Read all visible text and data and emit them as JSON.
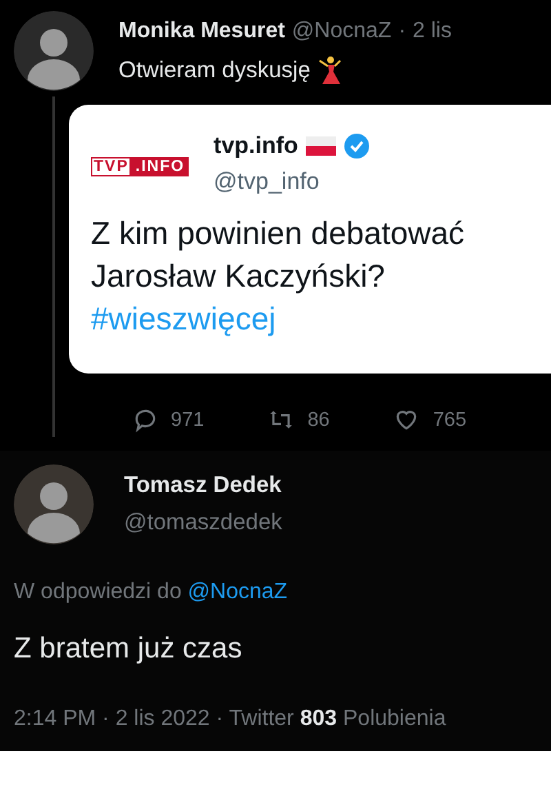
{
  "tweet": {
    "author": {
      "name": "Monika Mesuret",
      "handle": "@NocnaZ",
      "separator": "·",
      "time": "2 lis"
    },
    "text": "Otwieram dyskusję",
    "quoted": {
      "logo": {
        "left": "TVP",
        "right": ".INFO"
      },
      "name": "tvp.info",
      "handle": "@tvp_info",
      "verified": true,
      "text": "Z kim powinien debatować Jarosław Kaczyński?",
      "hashtag": "#wieszwięcej"
    },
    "stats": [
      {
        "kind": "reply",
        "count": "971"
      },
      {
        "kind": "retweet",
        "count": "86"
      },
      {
        "kind": "like",
        "count": "765"
      }
    ]
  },
  "reply": {
    "author": {
      "name": "Tomasz Dedek",
      "handle": "@tomaszdedek"
    },
    "in_reply_prefix": "W odpowiedzi do",
    "in_reply_to": "@NocnaZ",
    "text": "Z bratem już czas",
    "meta": {
      "time": "2:14 PM",
      "date": "2 lis 2022",
      "source": "Twitter",
      "separator": "·",
      "likes": "803",
      "likes_label": "Polubienia"
    }
  }
}
